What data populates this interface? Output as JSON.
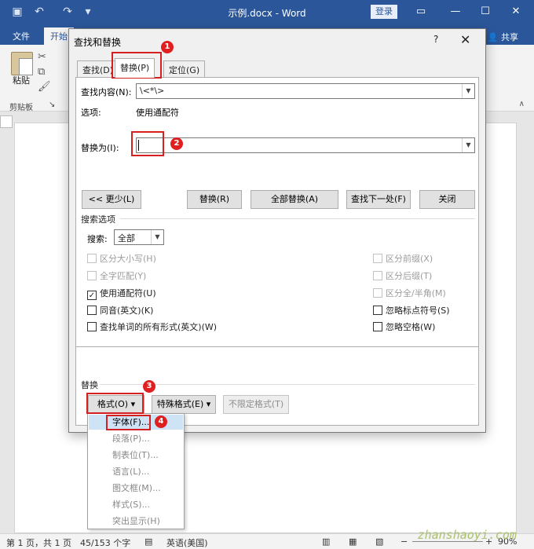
{
  "titlebar": {
    "doc_title": "示例.docx - Word",
    "login": "登录",
    "icons": [
      "save-icon",
      "undo-icon",
      "redo-icon",
      "customize-quick-access-icon"
    ],
    "window_icons": [
      "ribbon-display-icon",
      "minimize-icon",
      "maximize-icon",
      "close-icon"
    ]
  },
  "ribbon": {
    "tabs": [
      "文件",
      "开始"
    ],
    "share": "共享",
    "paste": "粘贴",
    "clipboard_group": "剪贴板",
    "collapse": "∧"
  },
  "dialog": {
    "title": "查找和替换",
    "help": "?",
    "close": "✕",
    "tabs": [
      "查找(D)",
      "替换(P)",
      "定位(G)"
    ],
    "find_label": "查找内容(N):",
    "find_value": "\\<*\\>",
    "options_label": "选项:",
    "options_value": "使用通配符",
    "replace_label": "替换为(I):",
    "replace_value": "",
    "buttons": {
      "less": "<< 更少(L)",
      "replace": "替换(R)",
      "replace_all": "全部替换(A)",
      "find_next": "查找下一处(F)",
      "close": "关闭"
    },
    "search_options_title": "搜索选项",
    "search_label": "搜索:",
    "search_value": "全部",
    "checkboxes_left": [
      {
        "label": "区分大小写(H)",
        "checked": false,
        "disabled": true
      },
      {
        "label": "全字匹配(Y)",
        "checked": false,
        "disabled": true
      },
      {
        "label": "使用通配符(U)",
        "checked": true,
        "disabled": false
      },
      {
        "label": "同音(英文)(K)",
        "checked": false,
        "disabled": false
      },
      {
        "label": "查找单词的所有形式(英文)(W)",
        "checked": false,
        "disabled": false
      }
    ],
    "checkboxes_right": [
      {
        "label": "区分前缀(X)",
        "checked": false,
        "disabled": true
      },
      {
        "label": "区分后缀(T)",
        "checked": false,
        "disabled": true
      },
      {
        "label": "区分全/半角(M)",
        "checked": false,
        "disabled": true
      },
      {
        "label": "忽略标点符号(S)",
        "checked": false,
        "disabled": false
      },
      {
        "label": "忽略空格(W)",
        "checked": false,
        "disabled": false
      }
    ],
    "replace_section_title": "替换",
    "format_button": "格式(O)",
    "special_button": "特殊格式(E)",
    "no_format_button": "不限定格式(T)"
  },
  "format_menu": {
    "items": [
      "字体(F)...",
      "段落(P)...",
      "制表位(T)...",
      "语言(L)...",
      "图文框(M)...",
      "样式(S)...",
      "突出显示(H)"
    ]
  },
  "annotations": [
    "1",
    "2",
    "3",
    "4"
  ],
  "statusbar": {
    "page": "第 1 页，共 1 页",
    "words": "45/153 个字",
    "language": "英语(美国)",
    "zoom": "90%"
  },
  "watermark": "zhanshaoyi.com",
  "colors": {
    "word_blue": "#2b579a",
    "annotation_red": "#d42020",
    "menu_highlight": "#cfe3f7"
  }
}
